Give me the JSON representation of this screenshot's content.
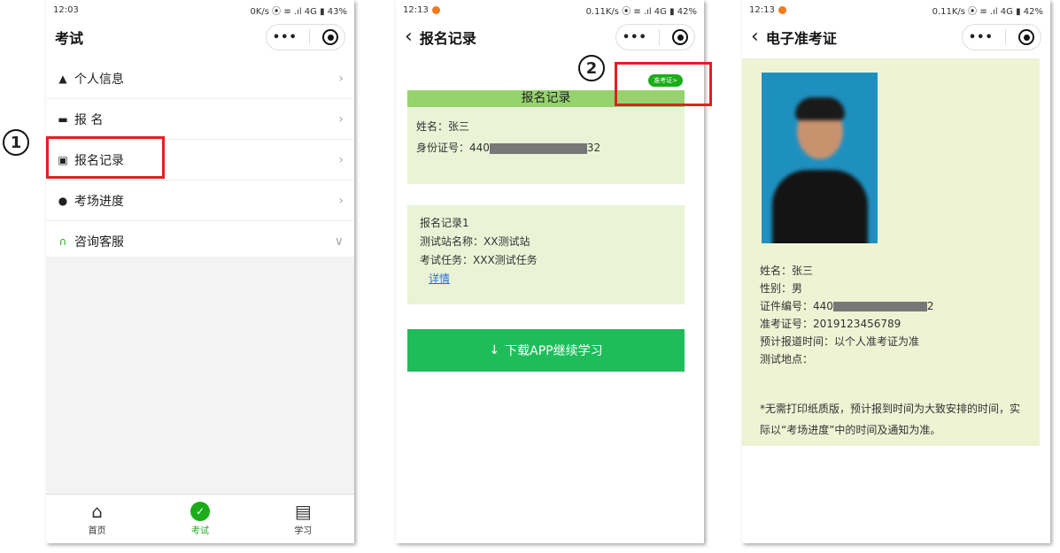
{
  "screen1": {
    "status_time": "12:03",
    "status_right": "0K/s ⦿ ≡ .ıl 4G ▮ 43%",
    "title": "考试",
    "menu": [
      {
        "icon": "user-icon",
        "glyph": "▲",
        "label": "个人信息",
        "chevron": "›"
      },
      {
        "icon": "id-card-icon",
        "glyph": "▬",
        "label": "报 名",
        "chevron": "›"
      },
      {
        "icon": "record-icon",
        "glyph": "▣",
        "label": "报名记录",
        "chevron": "›"
      },
      {
        "icon": "clock-icon",
        "glyph": "●",
        "label": "考场进度",
        "chevron": "›"
      },
      {
        "icon": "headset-icon",
        "glyph": "∩",
        "label": "咨询客服",
        "chevron": "∨"
      }
    ],
    "tabs": [
      {
        "icon": "home-icon",
        "glyph": "⌂",
        "label": "首页"
      },
      {
        "icon": "exam-icon",
        "glyph": "✓",
        "label": "考试"
      },
      {
        "icon": "book-icon",
        "glyph": "▤",
        "label": "学习"
      }
    ]
  },
  "screen2": {
    "status_time": "12:13",
    "status_right": "0.11K/s ⦿ ≡ .ıl 4G ▮ 42%",
    "title": "报名记录",
    "admit_badge": "准考证>",
    "card_title": "报名记录",
    "name_line": "姓名：张三",
    "id_prefix": "身份证号：440",
    "id_suffix": "32",
    "record_title": "报名记录1",
    "station": "测试站名称：XX测试站",
    "task": "考试任务：XXX测试任务",
    "detail_link": "详情",
    "download_arrow": "↓",
    "download_label": "下载APP继续学习"
  },
  "screen3": {
    "status_time": "12:13",
    "status_right": "0.11K/s ⦿ ≡ .ıl 4G ▮ 42%",
    "title": "电子准考证",
    "name": "姓名：张三",
    "gender": "性别：男",
    "cert_prefix": "证件编号：440",
    "cert_suffix": "2",
    "ticket_no": "准考证号：2019123456789",
    "report_time": "预计报道时间：以个人准考证为准",
    "location": "测试地点：",
    "note": "*无需打印纸质版，预计报到时间为大致安排的时间，实际以“考场进度”中的时间及通知为准。"
  },
  "annotations": {
    "step1": "1",
    "step2": "2"
  },
  "colors": {
    "accent_green": "#1aad19",
    "button_green": "#1ebd5a",
    "card_bg": "#eaf3d6",
    "card_header": "#96d36f",
    "highlight_red": "#e02020"
  }
}
